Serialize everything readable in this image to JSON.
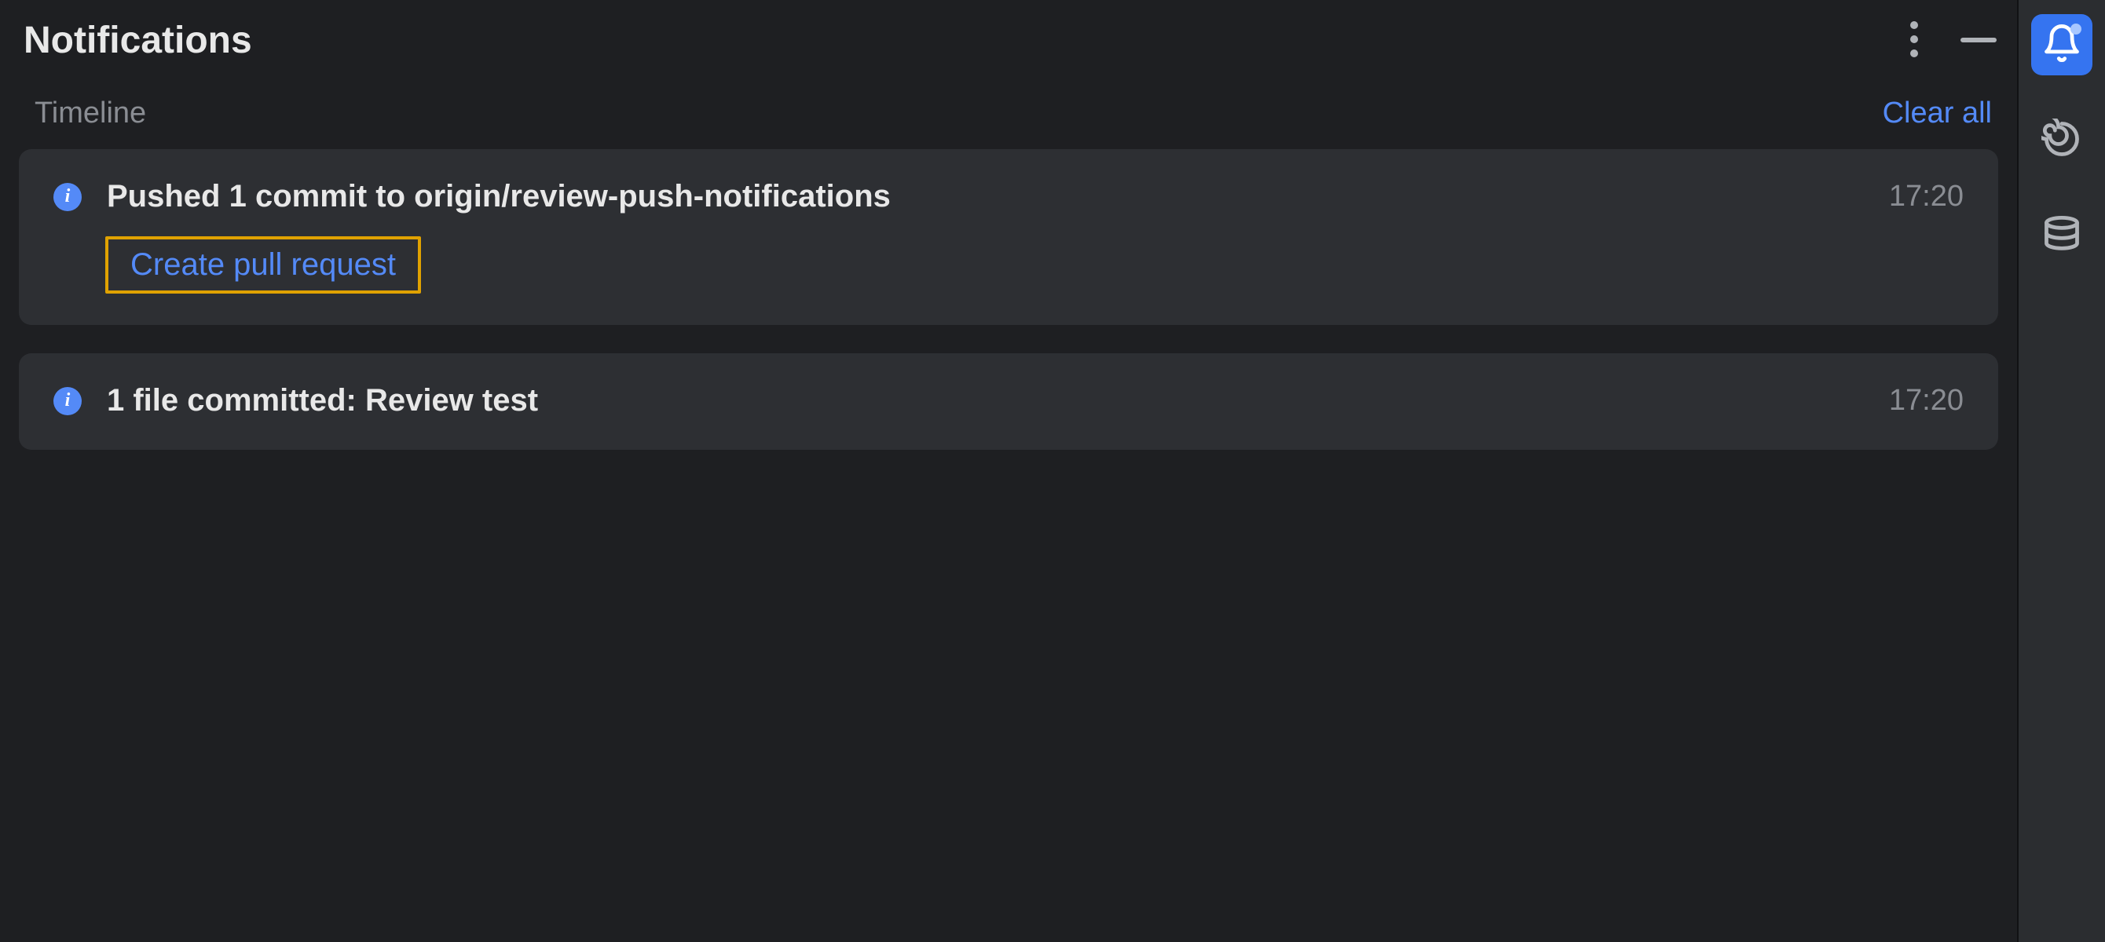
{
  "panel": {
    "title": "Notifications",
    "subheader_label": "Timeline",
    "clear_all_label": "Clear all"
  },
  "notifications": [
    {
      "title": "Pushed 1 commit to origin/review-push-notifications",
      "time": "17:20",
      "action_label": "Create pull request"
    },
    {
      "title": "1 file committed: Review test",
      "time": "17:20"
    }
  ],
  "colors": {
    "accent": "#548af7",
    "highlight_border": "#e0a200",
    "card_bg": "#2d2f33",
    "rail_bg": "#2b2d30",
    "rail_active": "#3574f0"
  }
}
